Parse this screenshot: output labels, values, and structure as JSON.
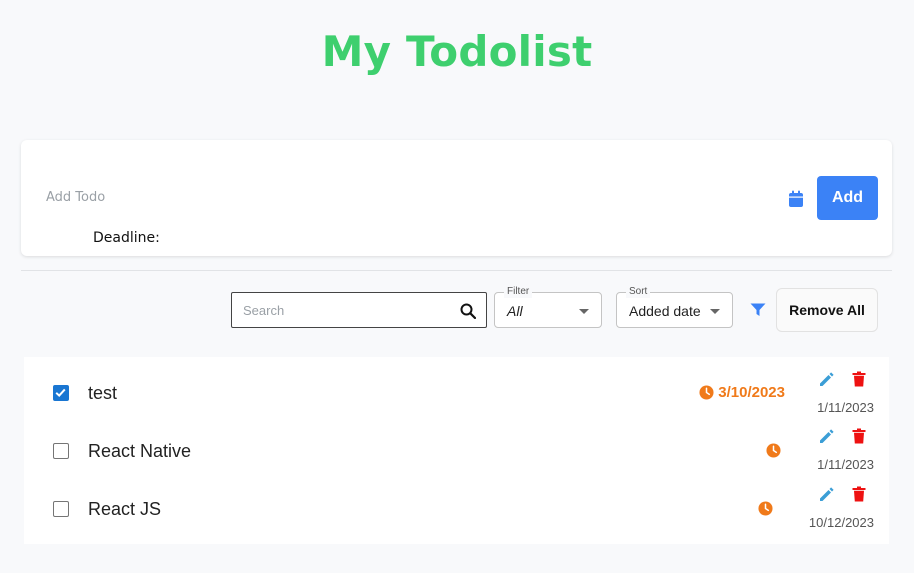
{
  "app": {
    "title": "My Todolist"
  },
  "add_form": {
    "input_label": "Add Todo",
    "deadline_label": "Deadline:",
    "add_button": "Add"
  },
  "toolbar": {
    "search_placeholder": "Search",
    "filter_label": "Filter",
    "filter_value": "All",
    "sort_label": "Sort",
    "sort_value": "Added date",
    "remove_all": "Remove All"
  },
  "todos": [
    {
      "text": "test",
      "checked": true,
      "deadline": "3/10/2023",
      "added": "1/11/2023"
    },
    {
      "text": "React Native",
      "checked": false,
      "deadline": "",
      "added": "1/11/2023"
    },
    {
      "text": "React JS",
      "checked": false,
      "deadline": "",
      "added": "10/12/2023"
    }
  ],
  "colors": {
    "title": "#3ecf6e",
    "primary": "#3b82f6",
    "deadline": "#f07a1a",
    "edit": "#3b9ed6",
    "delete": "#ee1111"
  },
  "icons": [
    "calendar-icon",
    "search-icon",
    "chevron-down-icon",
    "filter-icon",
    "checkmark-icon",
    "clock-icon",
    "pencil-icon",
    "trash-icon"
  ]
}
